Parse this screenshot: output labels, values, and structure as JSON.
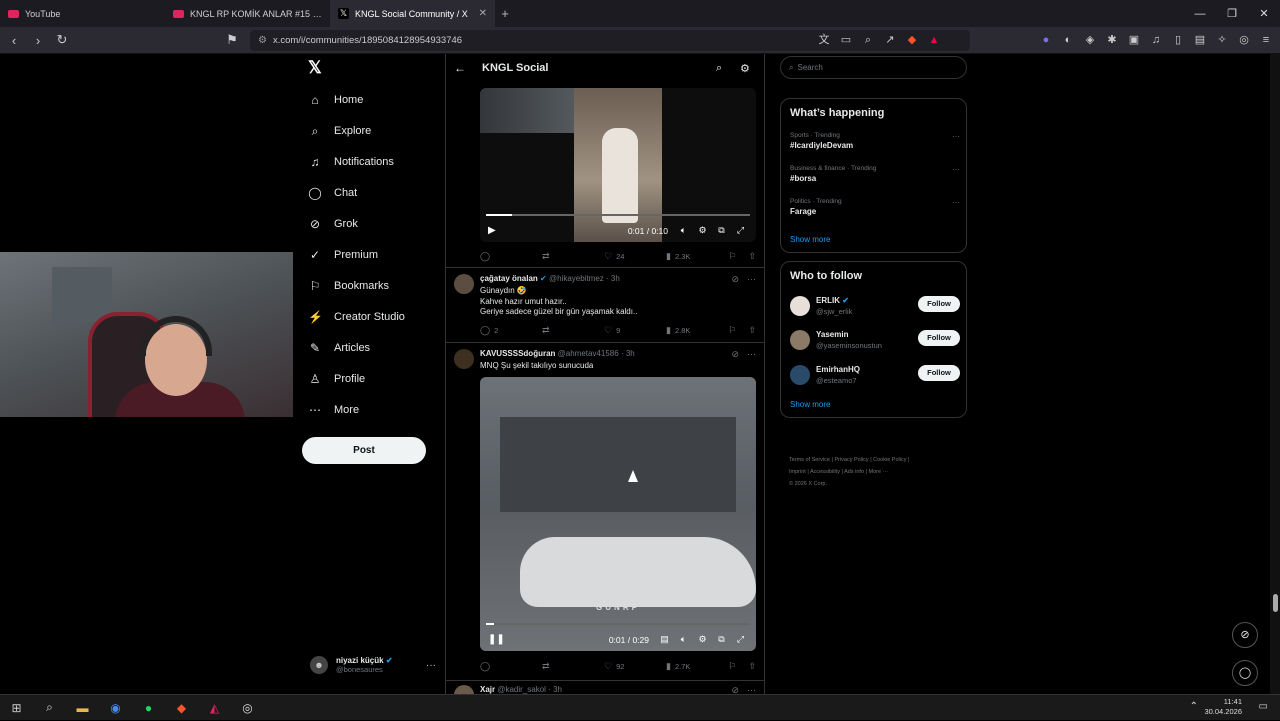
{
  "browser": {
    "tabs": [
      {
        "title": "YouTube"
      },
      {
        "title": "KNGL RP KOMİK ANLAR #15 - YouTu"
      },
      {
        "title": "KNGL Social Community / X"
      }
    ],
    "url": "x.com/i/communities/1895084128954933746"
  },
  "nav": {
    "items": [
      {
        "label": "Home",
        "icon": "home-icon"
      },
      {
        "label": "Explore",
        "icon": "search-icon"
      },
      {
        "label": "Notifications",
        "icon": "bell-icon"
      },
      {
        "label": "Chat",
        "icon": "chat-icon"
      },
      {
        "label": "Grok",
        "icon": "grok-icon"
      },
      {
        "label": "Premium",
        "icon": "premium-icon"
      },
      {
        "label": "Bookmarks",
        "icon": "bookmark-icon"
      },
      {
        "label": "Creator Studio",
        "icon": "creator-studio-icon"
      },
      {
        "label": "Articles",
        "icon": "articles-icon"
      },
      {
        "label": "Profile",
        "icon": "profile-icon"
      },
      {
        "label": "More",
        "icon": "more-icon"
      }
    ],
    "post_label": "Post",
    "account": {
      "name": "niyazi küçük",
      "handle": "@bonesaures"
    }
  },
  "main": {
    "title": "KNGL Social",
    "video1": {
      "time": "0:01 / 0:10",
      "progress": 0.1
    },
    "video1_actions": {
      "replies": "",
      "reposts": "",
      "likes": "24",
      "views": "2.3K"
    },
    "tweet1": {
      "name": "çağatay önalan",
      "handle": "@hikayebitmez",
      "age": "· 3h",
      "lines": [
        "Günaydın 🤣",
        "Kahve hazır umut hazır..",
        "Geriye sadece güzel bir gün yaşamak kaldı.."
      ],
      "actions": {
        "replies": "2",
        "reposts": "",
        "likes": "9",
        "views": "2.8K"
      }
    },
    "tweet2": {
      "name": "KAVUSSSSdoğuran",
      "handle": "@ahmetav41586",
      "age": "· 3h",
      "text": "MNQ Şu şekil takılıyo sunucuda",
      "video_watermark": "GUNRP",
      "video_time": "0:01 / 0:29",
      "progress": 0.03,
      "actions": {
        "replies": "",
        "reposts": "",
        "likes": "92",
        "views": "2.7K"
      }
    },
    "tweet3": {
      "name": "Xajr",
      "handle": "@kadir_sakol",
      "age": "· 3h"
    }
  },
  "sidebar": {
    "search_placeholder": "Search",
    "happening_title": "What’s happening",
    "trends": [
      {
        "meta": "Sports · Trending",
        "topic": "#IcardiyleDevam"
      },
      {
        "meta": "Business & finance · Trending",
        "topic": "#borsa"
      },
      {
        "meta": "Politics · Trending",
        "topic": "Farage"
      }
    ],
    "show_more": "Show more",
    "follow_title": "Who to follow",
    "follow": [
      {
        "name": "ERLIK",
        "handle": "@sjw_erlik"
      },
      {
        "name": "Yasemin",
        "handle": "@yaseminsonustun"
      },
      {
        "name": "EmirhanHQ",
        "handle": "@esteamo7"
      }
    ],
    "follow_label": "Follow",
    "footer_line1": "Terms of Service  |  Privacy Policy  |  Cookie Policy  |",
    "footer_line2": "Imprint  |  Accessibility  |  Ads info  |  More ···",
    "footer_line3": "© 2026 X Corp."
  },
  "taskbar": {
    "time": "11:41",
    "date": "30.04.2026"
  }
}
